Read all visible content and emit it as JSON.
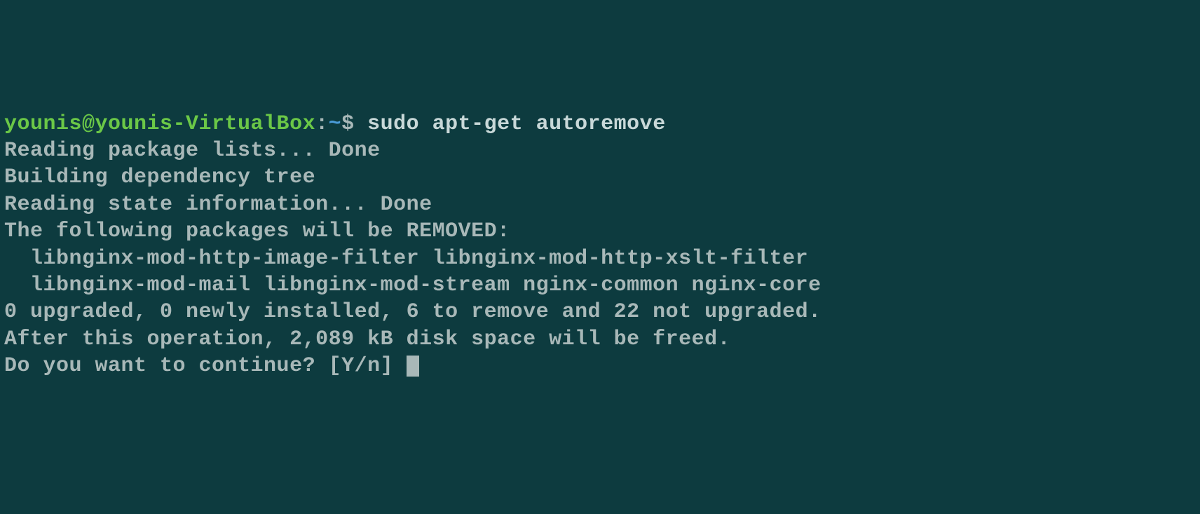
{
  "prompt": {
    "user_host": "younis@younis-VirtualBox",
    "colon": ":",
    "path": "~",
    "dollar": "$ ",
    "command": "sudo apt-get autoremove"
  },
  "output": {
    "line1": "Reading package lists... Done",
    "line2": "Building dependency tree",
    "line3": "Reading state information... Done",
    "line4": "The following packages will be REMOVED:",
    "line5": "  libnginx-mod-http-image-filter libnginx-mod-http-xslt-filter",
    "line6": "  libnginx-mod-mail libnginx-mod-stream nginx-common nginx-core",
    "line7": "0 upgraded, 0 newly installed, 6 to remove and 22 not upgraded.",
    "line8": "After this operation, 2,089 kB disk space will be freed.",
    "line9": "Do you want to continue? [Y/n] "
  }
}
